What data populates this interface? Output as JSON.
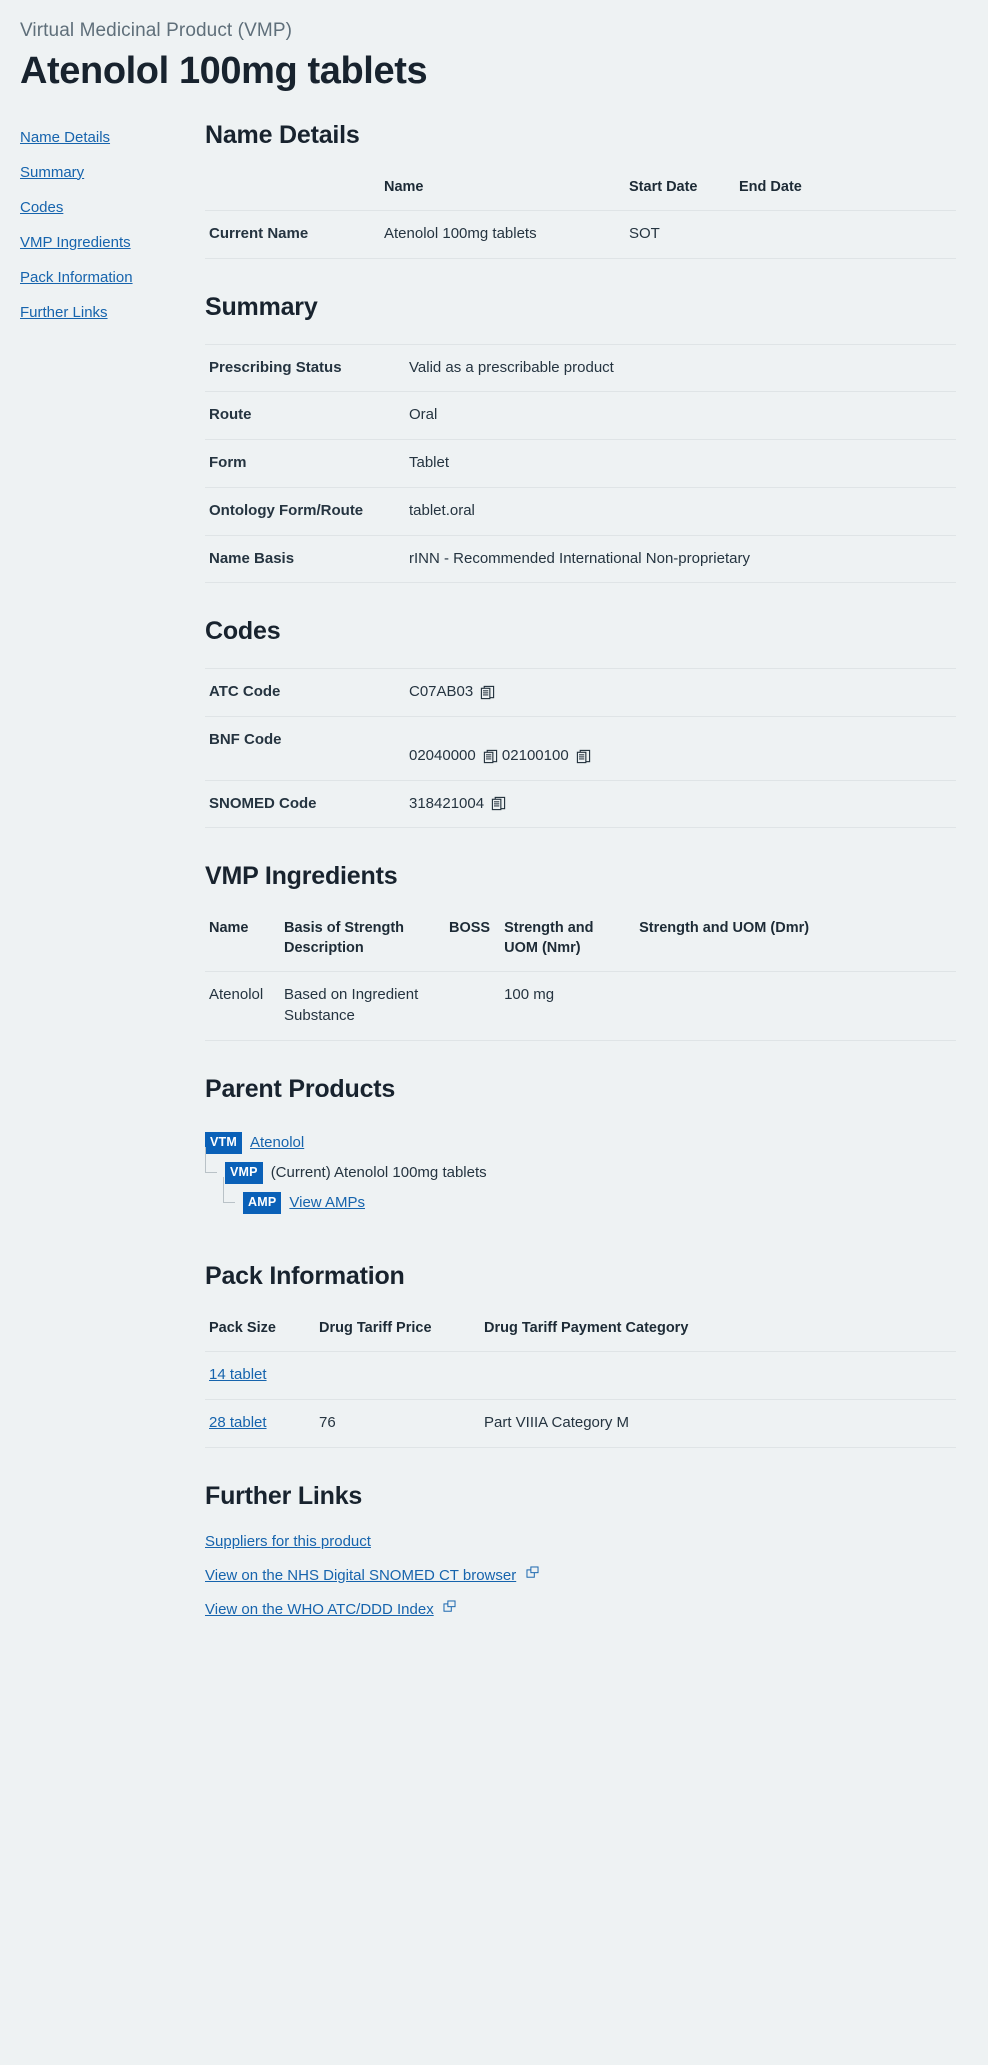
{
  "header": {
    "kicker": "Virtual Medicinal Product (VMP)",
    "title": "Atenolol 100mg tablets"
  },
  "sidebar": {
    "items": [
      {
        "label": "Name Details"
      },
      {
        "label": "Summary"
      },
      {
        "label": "Codes"
      },
      {
        "label": "VMP Ingredients"
      },
      {
        "label": "Pack Information"
      },
      {
        "label": "Further Links"
      }
    ]
  },
  "name_details": {
    "title": "Name Details",
    "columns": [
      "Name",
      "Start Date",
      "End Date"
    ],
    "rows": [
      {
        "label": "Current Name",
        "name": "Atenolol 100mg tablets",
        "start_date": "SOT",
        "end_date": ""
      }
    ]
  },
  "summary": {
    "title": "Summary",
    "rows": [
      {
        "label": "Prescribing Status",
        "value": "Valid as a prescribable product"
      },
      {
        "label": "Route",
        "value": "Oral"
      },
      {
        "label": "Form",
        "value": "Tablet"
      },
      {
        "label": "Ontology Form/Route",
        "value": "tablet.oral"
      },
      {
        "label": "Name Basis",
        "value": "rINN - Recommended International Non-proprietary"
      }
    ]
  },
  "codes": {
    "title": "Codes",
    "copy_icon": "copy-icon",
    "rows": [
      {
        "label": "ATC Code",
        "values": [
          "C07AB03"
        ]
      },
      {
        "label": "BNF Code",
        "values": [
          "02040000",
          "02100100"
        ]
      },
      {
        "label": "SNOMED Code",
        "values": [
          "318421004"
        ]
      }
    ]
  },
  "vmp_ingredients": {
    "title": "VMP Ingredients",
    "columns": [
      "Name",
      "Basis of Strength Description",
      "BOSS",
      "Strength and UOM (Nmr)",
      "Strength and UOM (Dmr)"
    ],
    "rows": [
      {
        "name": "Atenolol",
        "basis": "Based on Ingredient Substance",
        "boss": "",
        "strength_nmr": "100 mg",
        "strength_dmr": ""
      }
    ]
  },
  "parent_products": {
    "title": "Parent Products",
    "nodes": [
      {
        "badge": "VTM",
        "text": "Atenolol",
        "is_link": true,
        "level": 0
      },
      {
        "badge": "VMP",
        "text": "(Current) Atenolol 100mg tablets",
        "is_link": false,
        "level": 1
      },
      {
        "badge": "AMP",
        "text": "View AMPs",
        "is_link": true,
        "level": 2
      }
    ]
  },
  "pack_information": {
    "title": "Pack Information",
    "columns": [
      "Pack Size",
      "Drug Tariff Price",
      "Drug Tariff Payment Category"
    ],
    "rows": [
      {
        "pack_size": "14 tablet",
        "price": "",
        "category": ""
      },
      {
        "pack_size": "28 tablet",
        "price": "76",
        "category": "Part VIIIA Category M"
      }
    ]
  },
  "further_links": {
    "title": "Further Links",
    "links": [
      {
        "label": "Suppliers for this product",
        "external": false
      },
      {
        "label": "View on the NHS Digital SNOMED CT browser",
        "external": true
      },
      {
        "label": "View on the WHO ATC/DDD Index",
        "external": true
      }
    ]
  },
  "colors": {
    "background": "#eef2f3",
    "link": "#1664ad",
    "badge": "#0a61b8",
    "heading": "#18232e",
    "rule": "#dfe4e6"
  }
}
